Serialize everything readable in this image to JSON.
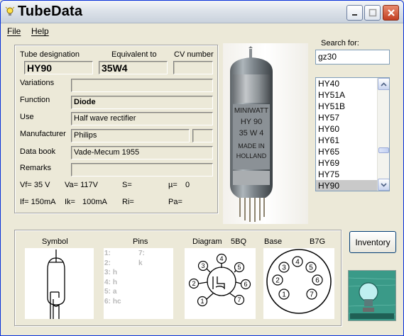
{
  "app": {
    "title": "TubeData"
  },
  "menu": {
    "file": "File",
    "help": "Help"
  },
  "labels": {
    "tube_designation": "Tube designation",
    "equivalent_to": "Equivalent to",
    "cv_number": "CV number",
    "variations": "Variations",
    "function": "Function",
    "use": "Use",
    "manufacturer": "Manufacturer",
    "data_book": "Data book",
    "remarks": "Remarks"
  },
  "values": {
    "tube_designation": "HY90",
    "equivalent_to": "35W4",
    "cv_number": "",
    "variations": "",
    "function": "Diode",
    "use": "Half wave rectifier",
    "manufacturer": "Philips",
    "data_book": "Vade-Mecum 1955",
    "remarks": ""
  },
  "params": {
    "vf": "Vf= 35 V",
    "va": "Va= 117V",
    "s": "S=",
    "mu": "µ=",
    "mu_value": "0",
    "if": "If= 150mA",
    "ik": "Ik=",
    "ik_value": "100mA",
    "ri": "Ri=",
    "pa": "Pa="
  },
  "search": {
    "label": "Search for:",
    "value": "gz30"
  },
  "tube_list": {
    "items": [
      "HY40",
      "HY51A",
      "HY51B",
      "HY57",
      "HY60",
      "HY61",
      "HY65",
      "HY69",
      "HY75",
      "HY90"
    ],
    "selected": "HY90"
  },
  "photo": {
    "print_lines": [
      "MINIWATT",
      "HY 90",
      "35 W 4",
      "MADE IN",
      "HOLLAND"
    ]
  },
  "bottom": {
    "symbol": "Symbol",
    "pins": "Pins",
    "diagram": "Diagram",
    "diagram_code": "5BQ",
    "base": "Base",
    "base_code": "B7G",
    "pin_lines": [
      {
        "num": "1:",
        "val": "",
        "num2": "7:",
        "val2": "k"
      },
      {
        "num": "2:",
        "val": ""
      },
      {
        "num": "3:",
        "val": "h"
      },
      {
        "num": "4:",
        "val": "h"
      },
      {
        "num": "5:",
        "val": "a"
      },
      {
        "num": "6:",
        "val": "hc"
      }
    ],
    "diagram_pins": [
      "1",
      "2",
      "3",
      "4",
      "5",
      "6",
      "7"
    ],
    "base_pins": [
      "1",
      "2",
      "3",
      "4",
      "5",
      "6",
      "7"
    ]
  },
  "buttons": {
    "inventory": "Inventory"
  },
  "icons": {
    "title": "lightbulb-icon",
    "minimize": "minimize-icon",
    "maximize": "maximize-icon",
    "close": "close-icon",
    "scroll_up": "chevron-up-icon",
    "scroll_down": "chevron-down-icon"
  },
  "colors": {
    "accent": "#0831d9",
    "close": "#c23f22",
    "selection": "#c9c9c9",
    "logo": "#2e8a7a"
  }
}
